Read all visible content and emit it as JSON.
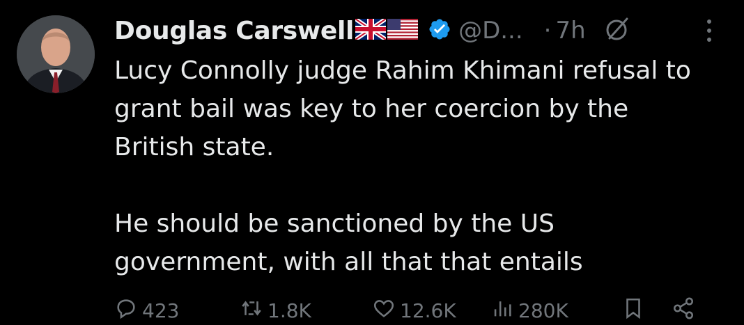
{
  "tweet": {
    "author_name": "Douglas Carswell",
    "handle": "@D...",
    "separator": "·",
    "time": "7h",
    "paragraphs": [
      "Lucy Connolly judge Rahim Khimani refusal to grant bail was key to her coercion by the British state.",
      "He should be sanctioned by the US government, with all that that entails"
    ],
    "flags": [
      "uk-flag-icon",
      "us-flag-icon"
    ],
    "verified_color": "#1d9bf0"
  },
  "actions": {
    "replies": "423",
    "reposts": "1.8K",
    "likes": "12.6K",
    "views": "280K"
  },
  "colors": {
    "background": "#000000",
    "text": "#e7e9ea",
    "secondary": "#71767b"
  }
}
